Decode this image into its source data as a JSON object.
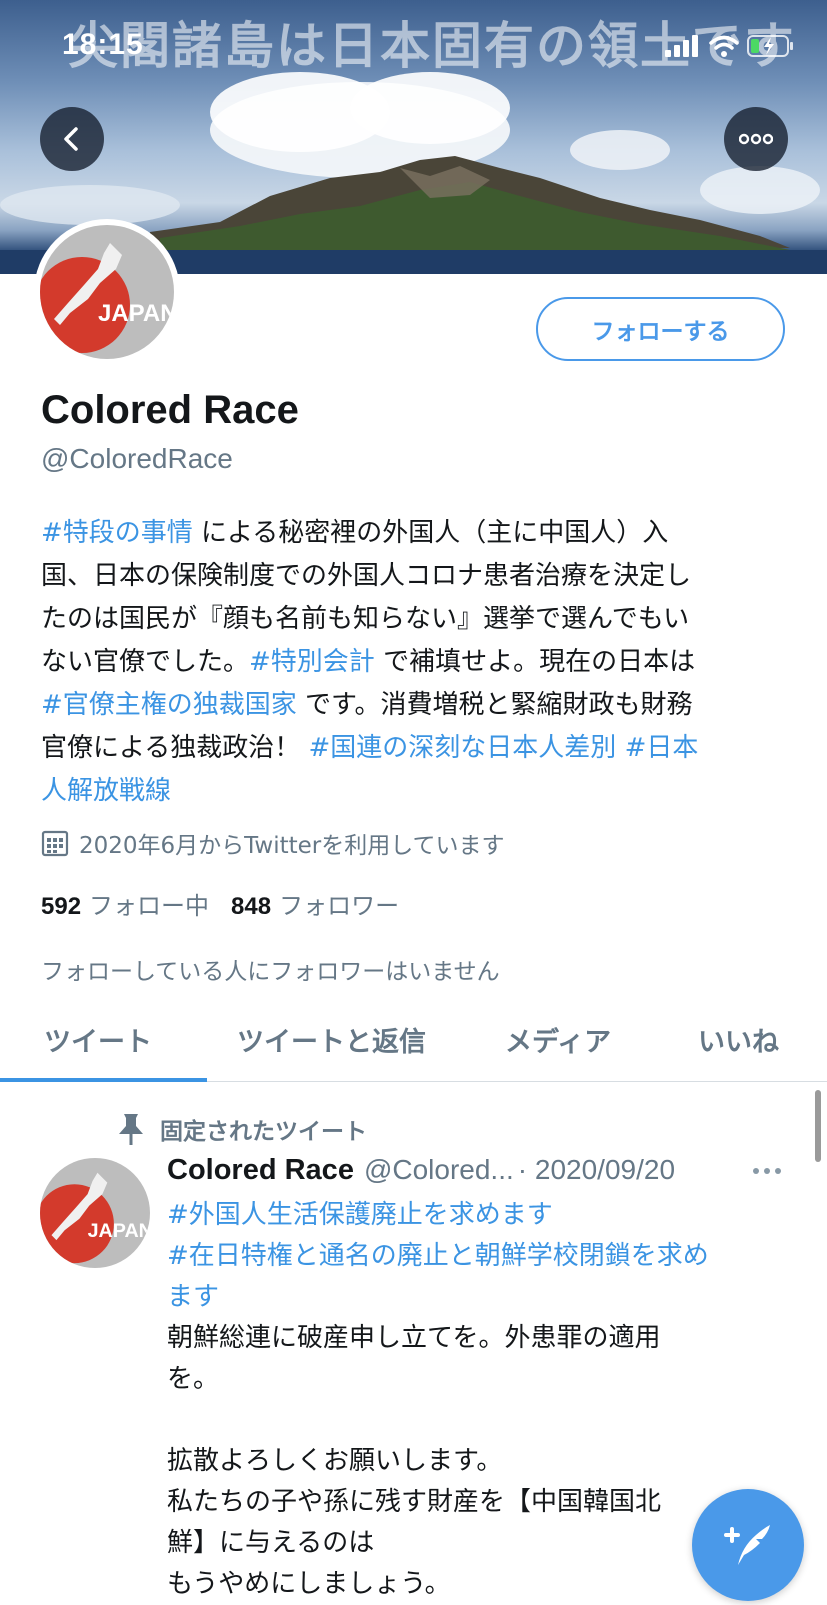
{
  "status_bar": {
    "time": "18:15"
  },
  "banner": {
    "caption": "尖閣諸島は日本固有の領土です"
  },
  "profile": {
    "avatar_text": "JAPAN",
    "follow_label": "フォローする",
    "display_name": "Colored Race",
    "handle": "@ColoredRace",
    "bio_lines": [
      [
        {
          "t": "#特段の事情",
          "tag": true
        },
        {
          "t": " による秘密裡の外国人（主に中国人）入",
          "tag": false
        }
      ],
      [
        {
          "t": "国、日本の保険制度での外国人コロナ患者治療を決定し",
          "tag": false
        }
      ],
      [
        {
          "t": "たのは国民が『顔も名前も知らない』選挙で選んでもい",
          "tag": false
        }
      ],
      [
        {
          "t": "ない官僚でした。",
          "tag": false
        },
        {
          "t": "#特別会計",
          "tag": true
        },
        {
          "t": " で補填せよ。現在の日本は",
          "tag": false
        }
      ],
      [
        {
          "t": "#官僚主権の独裁国家",
          "tag": true
        },
        {
          "t": " です。消費増税と緊縮財政も財務",
          "tag": false
        }
      ],
      [
        {
          "t": "官僚による独裁政治！ ",
          "tag": false
        },
        {
          "t": "#国連の深刻な日本人差別",
          "tag": true
        },
        {
          "t": " ",
          "tag": false
        },
        {
          "t": "#日本",
          "tag": true
        }
      ],
      [
        {
          "t": "人解放戦線",
          "tag": true
        }
      ]
    ],
    "joined": "2020年6月からTwitterを利用しています",
    "following_count": "592",
    "following_label": "フォロー中",
    "followers_count": "848",
    "followers_label": "フォロワー",
    "no_mutual": "フォローしている人にフォロワーはいません"
  },
  "tabs": [
    {
      "label": "ツイート",
      "active": true
    },
    {
      "label": "ツイートと返信",
      "active": false
    },
    {
      "label": "メディア",
      "active": false
    },
    {
      "label": "いいね",
      "active": false
    }
  ],
  "pinned_tweet": {
    "pin_label": "固定されたツイート",
    "name": "Colored Race",
    "handle": "@Colored...",
    "date": "· 2020/09/20",
    "avatar_text": "JAPAN",
    "body_lines": [
      {
        "t": "#外国人生活保護廃止を求めます",
        "tag": true
      },
      {
        "t": "#在日特権と通名の廃止と朝鮮学校閉鎖を求め",
        "tag": true
      },
      {
        "t": "ます",
        "tag": true
      },
      {
        "t": "朝鮮総連に破産申し立てを。外患罪の適用",
        "tag": false
      },
      {
        "t": "を。",
        "tag": false
      },
      {
        "t": "",
        "tag": false
      },
      {
        "t": "拡散よろしくお願いします。",
        "tag": false
      },
      {
        "t": "私たちの子や孫に残す財産を【中国韓国北",
        "tag": false
      },
      {
        "t": "鮮】に与えるのは",
        "tag": false
      },
      {
        "t": "もうやめにしましょう。",
        "tag": false
      }
    ]
  },
  "colors": {
    "accent": "#3b94e3",
    "muted": "#657786",
    "text": "#14171a"
  },
  "icons": [
    "back-arrow-icon",
    "more-horizontal-icon",
    "calendar-icon",
    "pin-icon",
    "compose-tweet-icon",
    "signal-icon",
    "wifi-icon",
    "battery-icon"
  ]
}
